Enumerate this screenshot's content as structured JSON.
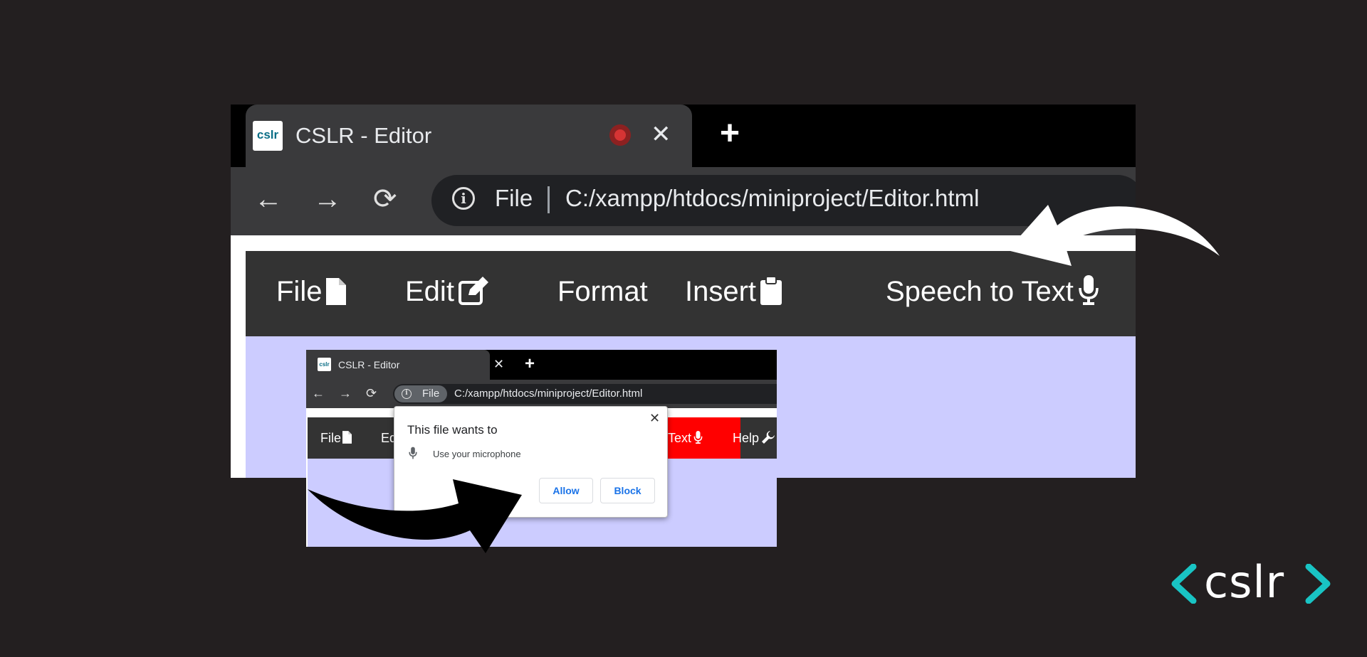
{
  "colors": {
    "page_background": "#231f20",
    "tab_active": "#3a3a3c",
    "tab_strip": "#000000",
    "menubar": "#333333",
    "editor_background": "#ccccff",
    "speech_highlight": "#ff0000",
    "link_blue": "#1a73e8",
    "logo_teal": "#19c4c4"
  },
  "big_browser": {
    "favicon_text": "cslr",
    "tab_title": "CSLR - Editor",
    "recording_icon": "record-icon",
    "close_glyph": "✕",
    "new_tab_glyph": "+",
    "back_glyph": "←",
    "forward_glyph": "→",
    "reload_glyph": "⟳",
    "info_glyph": "i",
    "chip_label": "File",
    "url": "C:/xampp/htdocs/miniproject/Editor.html",
    "menu": {
      "file": "File",
      "edit": "Edit",
      "format": "Format",
      "insert": "Insert",
      "speech": "Speech to Text"
    }
  },
  "small_browser": {
    "favicon_text": "cslr",
    "tab_title": "CSLR - Editor",
    "close_glyph": "✕",
    "new_tab_glyph": "+",
    "back_glyph": "←",
    "forward_glyph": "→",
    "reload_glyph": "⟳",
    "info_glyph": "i",
    "chip_label": "File",
    "url": "C:/xampp/htdocs/miniproject/Editor.html",
    "menu": {
      "file": "File",
      "edit_partial": "Ed",
      "speech_partial": "Text",
      "help": "Help"
    }
  },
  "permission_popup": {
    "title": "This file wants to",
    "permission": "Use your microphone",
    "allow_label": "Allow",
    "block_label": "Block",
    "close_glyph": "✕"
  },
  "logo": {
    "text": "cslr"
  }
}
